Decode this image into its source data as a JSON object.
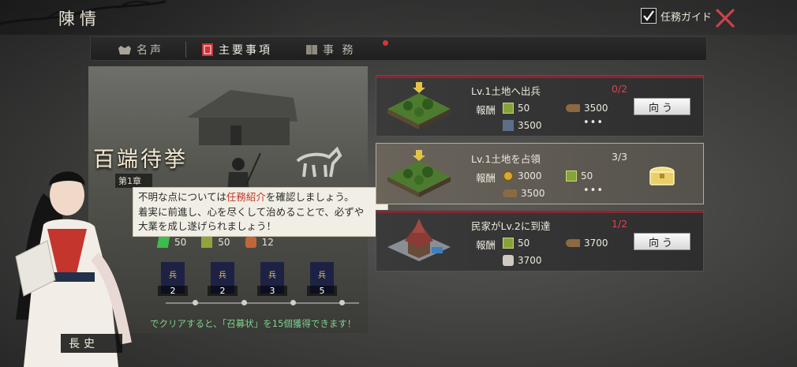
{
  "header": {
    "title": "陳情",
    "guide_label": "任務ガイド",
    "guide_checked": true
  },
  "tabs": [
    {
      "label": "名声",
      "icon": "helmet-icon"
    },
    {
      "label": "主要事項",
      "icon": "seal-icon",
      "active": true,
      "badge": true
    },
    {
      "label": "事 務",
      "icon": "book-icon"
    }
  ],
  "story": {
    "title": "百端待挙",
    "chapter": "第1章",
    "rewards": [
      {
        "icon": "green-crystal-icon",
        "value": "50"
      },
      {
        "icon": "green-chest-icon",
        "value": "50"
      },
      {
        "icon": "horse-icon",
        "value": "12"
      }
    ],
    "milestones": [
      "2",
      "2",
      "3",
      "5"
    ],
    "clear_message": "でクリアすると、「召募状」を15個獲得できます！"
  },
  "character": {
    "name": "長史"
  },
  "tooltip": {
    "line1_pre": "不明な点については",
    "line1_link": "任務紹介",
    "line1_post": "を確認しましょう。",
    "line2": "着実に前進し、心を尽くして治めることで、必ずや",
    "line3": "大業を成し遂げられましょう！"
  },
  "missions": [
    {
      "title": "Lv.1土地へ出兵",
      "count": "0/2",
      "reward_label": "報酬",
      "rewards": [
        {
          "icon": "green-box-icon",
          "value": "50"
        },
        {
          "icon": "wood-icon",
          "value": "3500"
        },
        {
          "icon": "iron-icon",
          "value": "3500"
        }
      ],
      "more": "•••",
      "button": "向う",
      "done": false
    },
    {
      "title": "Lv.1土地を占領",
      "count": "3/3",
      "reward_label": "報酬",
      "rewards": [
        {
          "icon": "coin-icon",
          "value": "3000"
        },
        {
          "icon": "green-box-icon",
          "value": "50"
        },
        {
          "icon": "wood-icon",
          "value": "3500"
        }
      ],
      "more": "•••",
      "done": true
    },
    {
      "title": "民家がLv.2に到達",
      "count": "1/2",
      "reward_label": "報酬",
      "rewards": [
        {
          "icon": "green-box-icon",
          "value": "50"
        },
        {
          "icon": "wood-icon",
          "value": "3700"
        },
        {
          "icon": "stone-icon",
          "value": "3700"
        }
      ],
      "button": "向う",
      "done": false
    }
  ],
  "colors": {
    "accent_red": "#8b2530",
    "count_red": "#e0434b",
    "link_red": "#c0392b",
    "clear_green": "#7fd28c"
  }
}
